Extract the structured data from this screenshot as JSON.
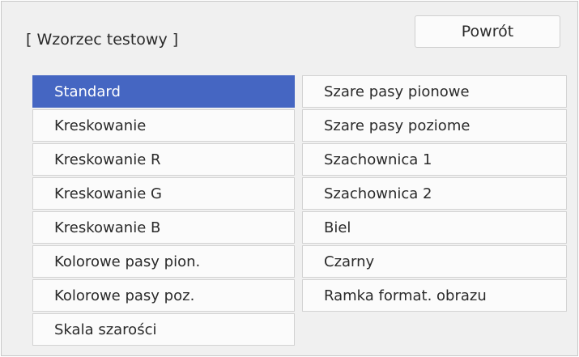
{
  "title": "[ Wzorzec testowy ]",
  "return_button": "Powrót",
  "accent_color": "#4566c2",
  "selected_item": "Standard",
  "left_items": [
    "Standard",
    "Kreskowanie",
    "Kreskowanie R",
    "Kreskowanie G",
    "Kreskowanie B",
    "Kolorowe pasy pion.",
    "Kolorowe pasy poz.",
    "Skala szarości"
  ],
  "right_items": [
    "Szare pasy pionowe",
    "Szare pasy poziome",
    "Szachownica 1",
    "Szachownica 2",
    "Biel",
    "Czarny",
    "Ramka format. obrazu"
  ]
}
